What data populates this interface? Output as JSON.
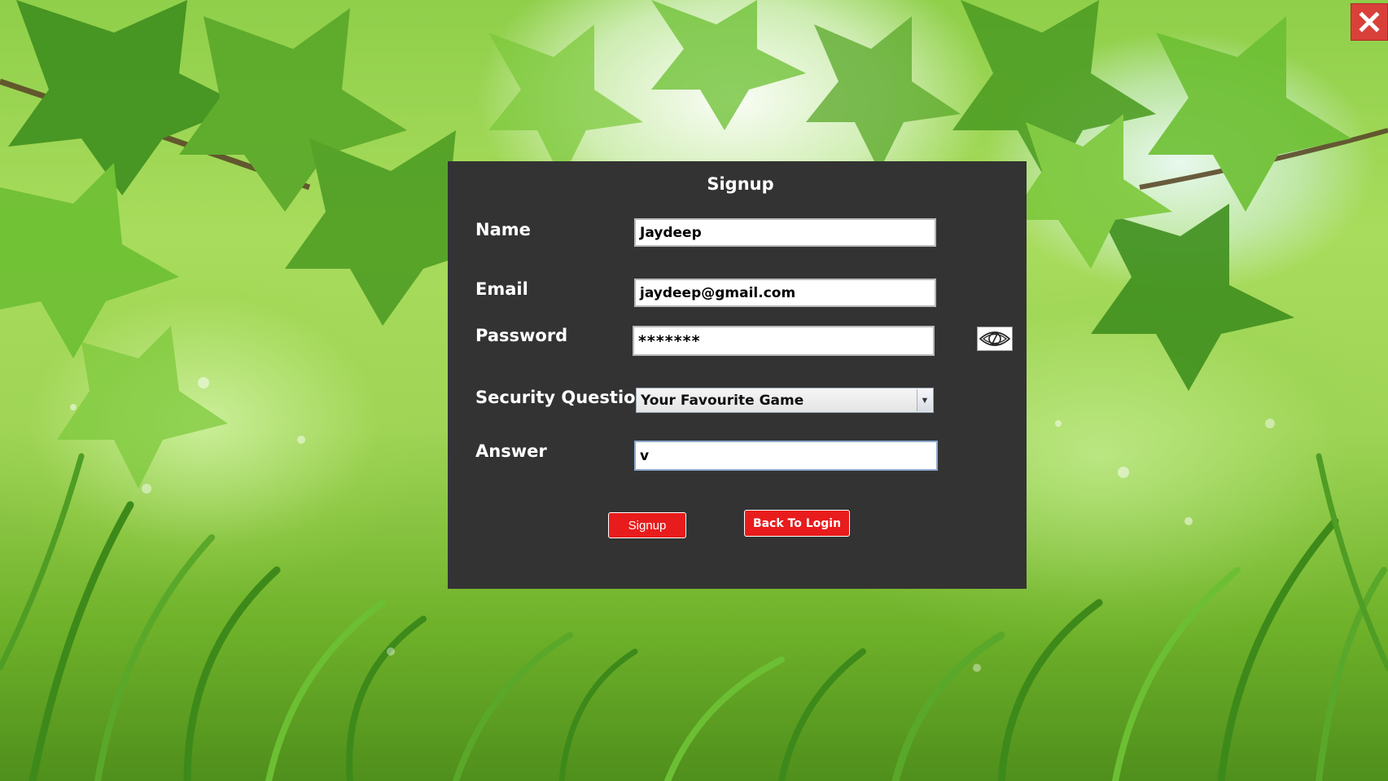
{
  "window": {
    "close_icon": "close-icon",
    "close_color": "#d9403a"
  },
  "form": {
    "title": "Signup",
    "name_label": "Name",
    "name_value": "Jaydeep",
    "email_label": "Email",
    "email_value": "jaydeep@gmail.com",
    "password_label": "Password",
    "password_value": "*******",
    "password_toggle_icon": "eye-slash-icon",
    "security_question_label": "Security Question",
    "security_question_selected": "Your Favourite Game",
    "answer_label": "Answer",
    "answer_value": "v",
    "signup_button": "Signup",
    "back_button": "Back To Login",
    "button_color": "#e81c1c",
    "panel_color": "#333333"
  }
}
